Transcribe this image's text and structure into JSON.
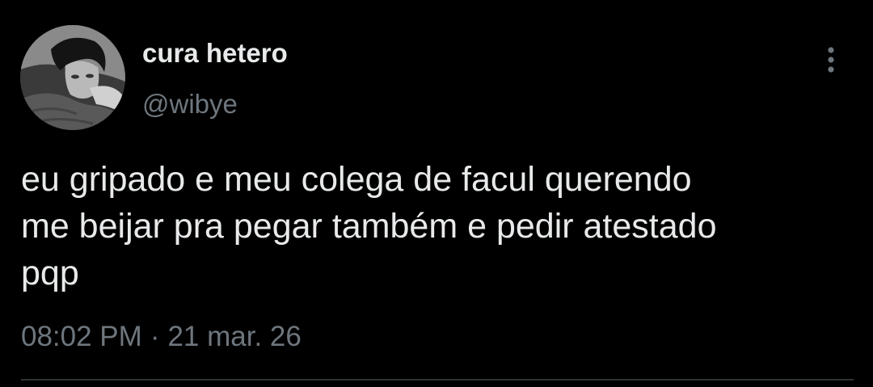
{
  "tweet": {
    "display_name": "cura hetero",
    "handle": "@wibye",
    "text_lines": [
      "eu gripado e meu colega de facul querendo",
      "me beijar pra pegar também e pedir atestado",
      "pqp"
    ],
    "time": "08:02 PM",
    "separator": "·",
    "date": "21 mar. 26"
  },
  "icons": {
    "more": "more-vertical-icon",
    "avatar": "profile-photo"
  },
  "colors": {
    "background": "#000000",
    "primary_text": "#e7e9ea",
    "secondary_text": "#6e767d",
    "divider": "#2f3336"
  }
}
